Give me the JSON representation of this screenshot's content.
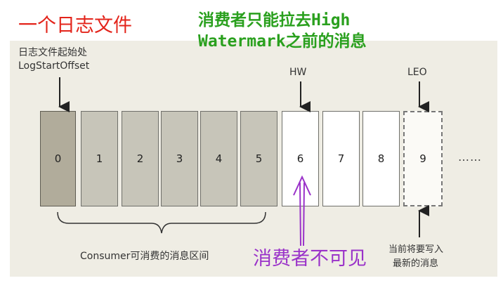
{
  "annotations": {
    "log_file": "一个日志文件",
    "hw_note_line1": "消费者只能拉去High",
    "hw_note_line2": "Watermark之前的消息",
    "invisible_note": "消费者不可见"
  },
  "labels": {
    "log_start_line1": "日志文件起始处",
    "log_start_line2": "LogStartOffset",
    "hw": "HW",
    "leo": "LEO",
    "consumer_range": "Consumer可消费的消息区间",
    "next_write_line1": "当前将要写入",
    "next_write_line2": "最新的消息",
    "ellipsis": "……"
  },
  "cells": [
    {
      "offset": "0",
      "state": "first"
    },
    {
      "offset": "1",
      "state": "read"
    },
    {
      "offset": "2",
      "state": "read"
    },
    {
      "offset": "3",
      "state": "read"
    },
    {
      "offset": "4",
      "state": "read"
    },
    {
      "offset": "5",
      "state": "read"
    },
    {
      "offset": "6",
      "state": "unread"
    },
    {
      "offset": "7",
      "state": "unread"
    },
    {
      "offset": "8",
      "state": "unread"
    },
    {
      "offset": "9",
      "state": "leo"
    }
  ],
  "colors": {
    "red_annotation": "#e3241b",
    "green_annotation": "#2aa01e",
    "purple_annotation": "#9a32c9"
  }
}
